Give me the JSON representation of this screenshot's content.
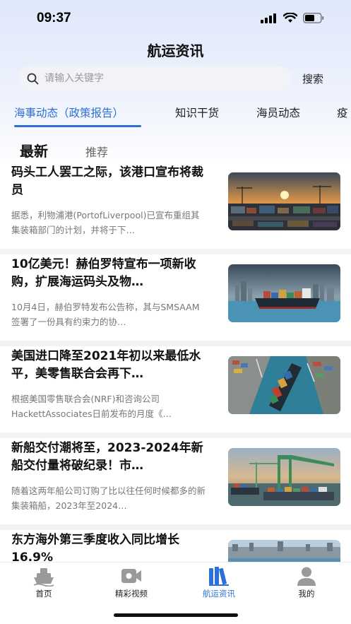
{
  "status_bar": {
    "time": "09:37"
  },
  "header": {
    "title": "航运资讯"
  },
  "search": {
    "placeholder": "请输入关键字",
    "button_label": "搜索"
  },
  "category_tabs": [
    {
      "label": "海事动态（政策报告）",
      "active": true
    },
    {
      "label": "知识干货",
      "active": false
    },
    {
      "label": "海员动态",
      "active": false
    },
    {
      "label": "疫",
      "active": false
    }
  ],
  "sub_tabs": {
    "latest": "最新",
    "recommended": "推荐"
  },
  "news": [
    {
      "title": "码头工人罢工之际，该港口宣布将裁员",
      "summary": "据悉，利物浦港(PortofLiverpool)已宣布重组其集装箱部门的计划，并将于下…",
      "thumb": "sunset-port"
    },
    {
      "title": "10亿美元！赫伯罗特宣布一项新收购，扩展海运码头及物…",
      "summary": "10月4日，赫伯罗特发布公告称，其与SMSAAM签署了一份具有约束力的协…",
      "thumb": "container-ship-city"
    },
    {
      "title": "美国进口降至2021年初以来最低水平，美零售联合会再下…",
      "summary": "根据美国零售联合会(NRF)和咨询公司HackettAssociates日前发布的月度《…",
      "thumb": "aerial-port"
    },
    {
      "title": "新船交付潮将至，2023-2024年新船交付量将破纪录！市…",
      "summary": "随着这两年船公司订购了比以往任何时候都多的新集装箱船，2023年至2024…",
      "thumb": "crane-terminal"
    },
    {
      "title": "东方海外第三季度收入同比增长16.9%",
      "summary": "",
      "thumb": "harbor-skyline"
    }
  ],
  "tab_bar": [
    {
      "label": "首页",
      "icon": "ship-icon",
      "active": false
    },
    {
      "label": "精彩视频",
      "icon": "video-camera-icon",
      "active": false
    },
    {
      "label": "航运资讯",
      "icon": "books-icon",
      "active": true
    },
    {
      "label": "我的",
      "icon": "user-icon",
      "active": false
    }
  ],
  "colors": {
    "accent": "#2c6fd8",
    "inactive_icon": "#9a9a9a"
  }
}
